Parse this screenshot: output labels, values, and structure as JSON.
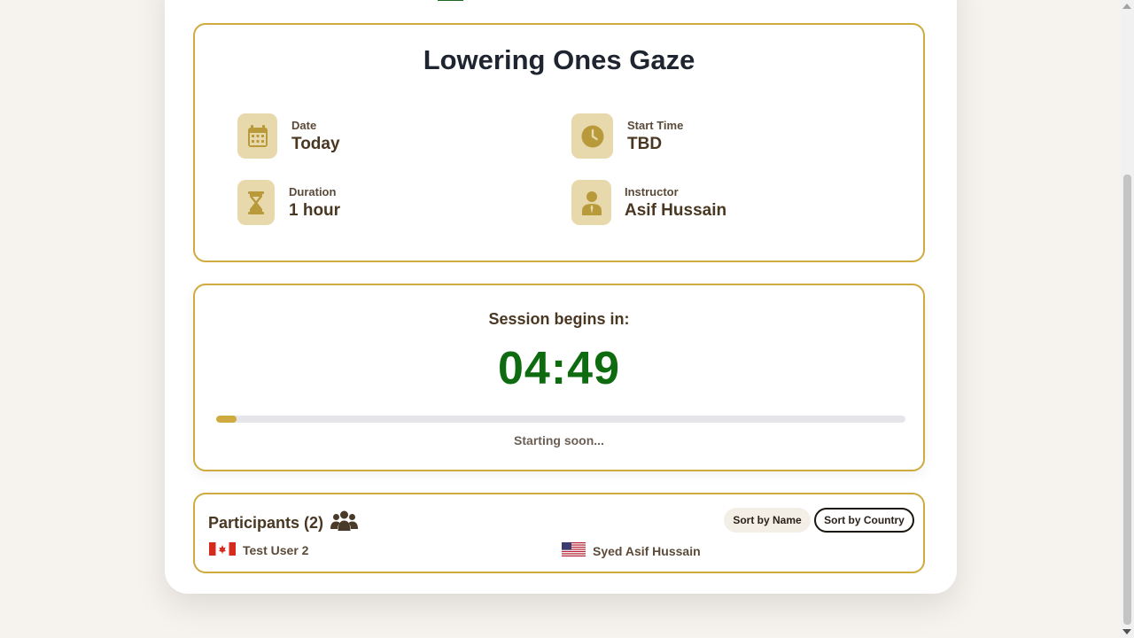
{
  "session": {
    "title": "Lowering Ones Gaze",
    "details": [
      {
        "label": "Date",
        "value": "Today",
        "icon": "calendar-icon"
      },
      {
        "label": "Start Time",
        "value": "TBD",
        "icon": "clock-icon"
      },
      {
        "label": "Duration",
        "value": "1 hour",
        "icon": "hourglass-icon"
      },
      {
        "label": "Instructor",
        "value": "Asif Hussain",
        "icon": "instructor-icon"
      }
    ]
  },
  "timer": {
    "heading": "Session begins in:",
    "countdown": "04:49",
    "progress_percent": 3,
    "status": "Starting soon..."
  },
  "participants": {
    "title": "Participants (2)",
    "sort_name_label": "Sort by Name",
    "sort_country_label": "Sort by Country",
    "list": [
      {
        "name": "Test User 2",
        "flag": "canada-flag-icon"
      },
      {
        "name": "Syed Asif Hussain",
        "flag": "usa-flag-icon"
      }
    ]
  },
  "colors": {
    "accent": "#cfaa3f",
    "countdown": "#0f6b10",
    "icon_bg": "#e8d9ad",
    "icon": "#b99a3a"
  }
}
